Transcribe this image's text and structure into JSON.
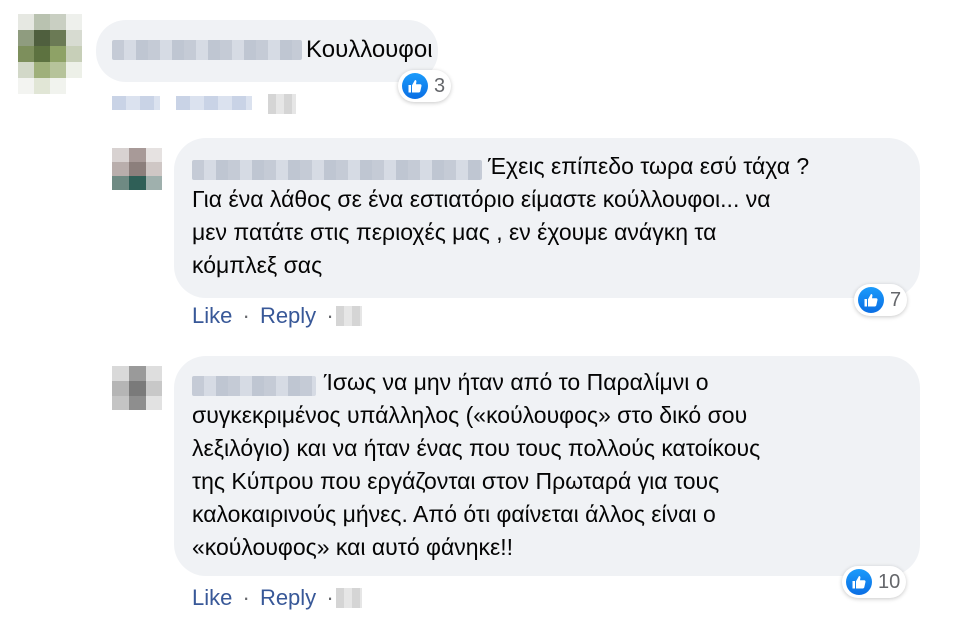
{
  "colors": {
    "link": "#385898",
    "bubble": "#f0f2f5",
    "like_blue": "#0a6ee4",
    "meta_gray": "#65676b"
  },
  "comments": [
    {
      "text": "Κουλλουφοι",
      "reaction_icon": "like-icon",
      "reaction_count": "3"
    },
    {
      "text": "Έχεις επίπεδο τωρα εσύ τάχα ?\nΓια ένα λάθος σε ένα εστιατόριο είμαστε κούλλουφοι... να\nμεν πατάτε στις περιοχές μας , εν έχουμε ανάγκη τα\nκόμπλεξ σας",
      "reaction_icon": "like-icon",
      "reaction_count": "7",
      "like_label": "Like",
      "reply_label": "Reply",
      "separator": "·"
    },
    {
      "text": "Ίσως να μην ήταν από το Παραλίμνι ο\nσυγκεκριμένος υπάλληλος («κούλουφος» στο δικό σου\nλεξιλόγιο) και να ήταν ένας που τους πολλούς κατοίκους\nτης Κύπρου που εργάζονται στον Πρωταρά για τους\nκαλοκαιρινούς μήνες. Από ότι φαίνεται άλλος είναι ο\n«κούλουφος» και αυτό φάνηκε!!",
      "reaction_icon": "like-icon",
      "reaction_count": "10",
      "like_label": "Like",
      "reply_label": "Reply",
      "separator": "·"
    }
  ]
}
